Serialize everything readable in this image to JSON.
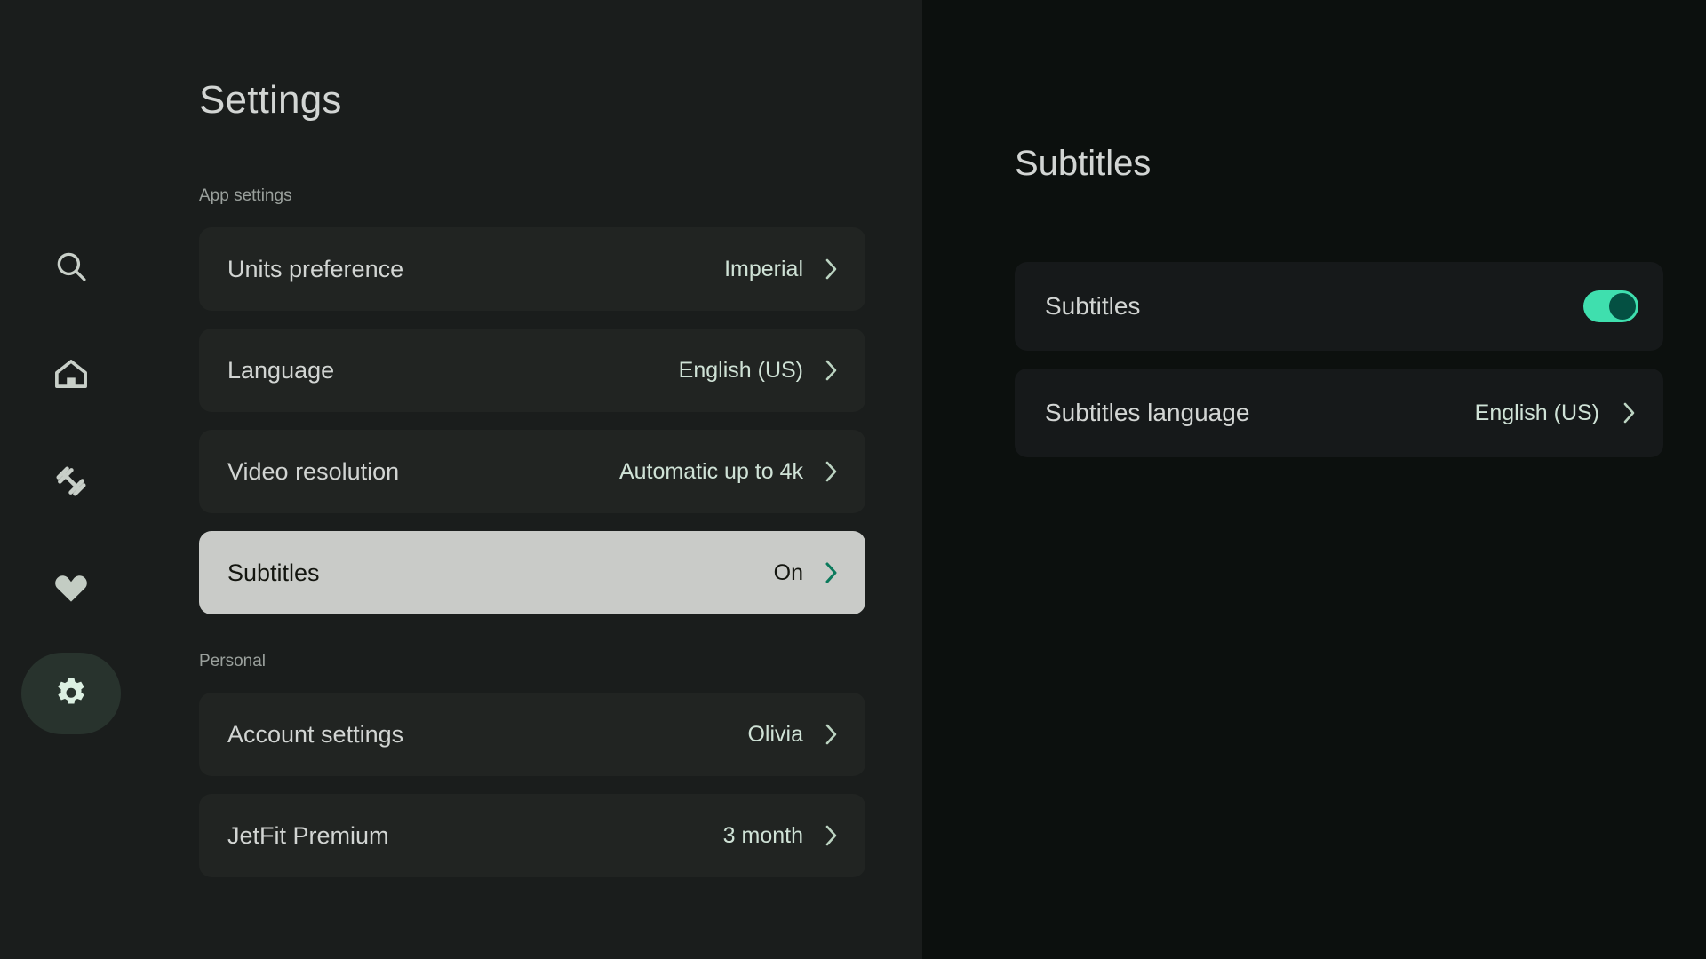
{
  "sidebar": {
    "items": [
      {
        "name": "search-icon",
        "label": "Search",
        "active": false
      },
      {
        "name": "home-icon",
        "label": "Home",
        "active": false
      },
      {
        "name": "dumbbell-icon",
        "label": "Workouts",
        "active": false
      },
      {
        "name": "heart-icon",
        "label": "Favorites",
        "active": false
      },
      {
        "name": "gear-icon",
        "label": "Settings",
        "active": true
      }
    ]
  },
  "left": {
    "title": "Settings",
    "sections": [
      {
        "label": "App settings",
        "rows": [
          {
            "label": "Units preference",
            "value": "Imperial",
            "selected": false
          },
          {
            "label": "Language",
            "value": "English (US)",
            "selected": false
          },
          {
            "label": "Video resolution",
            "value": "Automatic up to 4k",
            "selected": false
          },
          {
            "label": "Subtitles",
            "value": "On",
            "selected": true
          }
        ]
      },
      {
        "label": "Personal",
        "rows": [
          {
            "label": "Account settings",
            "value": "Olivia",
            "selected": false
          },
          {
            "label": "JetFit Premium",
            "value": "3 month",
            "selected": false
          }
        ]
      }
    ]
  },
  "right": {
    "title": "Subtitles",
    "rows": [
      {
        "label": "Subtitles",
        "control": "toggle",
        "value": "On"
      },
      {
        "label": "Subtitles language",
        "control": "chevron",
        "value": "English (US)"
      }
    ]
  },
  "colors": {
    "left_bg": "#1a1d1c",
    "right_bg": "#0c100e",
    "row_bg": "#212422",
    "row_selected_bg": "#c9cbc8",
    "accent_toggle": "#3fdfae",
    "accent_knob": "#045042",
    "value_text": "#cfe2d6",
    "chevron_selected": "#0b7a5c",
    "rail_active_bg": "#28332d"
  }
}
